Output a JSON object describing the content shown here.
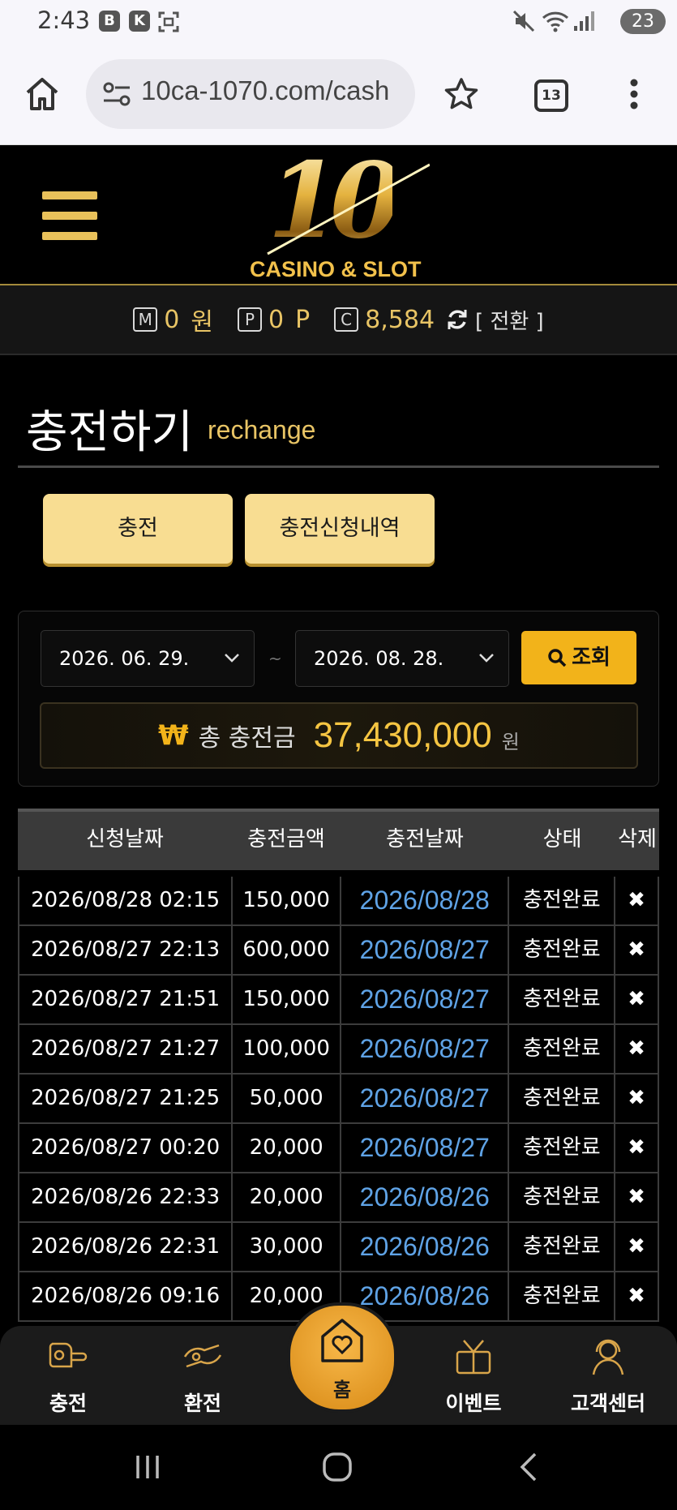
{
  "status_bar": {
    "time": "2:43",
    "apps": [
      "B",
      "K"
    ],
    "battery": "23"
  },
  "browser": {
    "url": "10ca-1070.com/cash",
    "tab_count": "13"
  },
  "site": {
    "logo_number": "10",
    "logo_text": "CASINO & SLOT"
  },
  "balance": {
    "money_icon": "M",
    "money_value": "0",
    "money_unit": "원",
    "point_icon": "P",
    "point_value": "0",
    "point_unit": "P",
    "coin_icon": "C",
    "coin_value": "8,584",
    "convert_label": "[ 전환 ]"
  },
  "page": {
    "title": "충전하기",
    "subtitle": "rechange",
    "tabs": [
      "충전",
      "충전신청내역"
    ]
  },
  "filter": {
    "start_date": "2026. 06. 29.",
    "separator": "~",
    "end_date": "2026. 08. 28.",
    "search_label": "조회",
    "total_sign": "₩",
    "total_label": "총 충전금",
    "total_value": "37,430,000",
    "total_unit": "원"
  },
  "table": {
    "headers": [
      "신청날짜",
      "충전금액",
      "충전날짜",
      "상태",
      "삭제"
    ],
    "rows": [
      [
        "2026/08/28 02:15",
        "150,000",
        "2026/08/28",
        "충전완료",
        "✖"
      ],
      [
        "2026/08/27 22:13",
        "600,000",
        "2026/08/27",
        "충전완료",
        "✖"
      ],
      [
        "2026/08/27 21:51",
        "150,000",
        "2026/08/27",
        "충전완료",
        "✖"
      ],
      [
        "2026/08/27 21:27",
        "100,000",
        "2026/08/27",
        "충전완료",
        "✖"
      ],
      [
        "2026/08/27 21:25",
        "50,000",
        "2026/08/27",
        "충전완료",
        "✖"
      ],
      [
        "2026/08/27 00:20",
        "20,000",
        "2026/08/27",
        "충전완료",
        "✖"
      ],
      [
        "2026/08/26 22:33",
        "20,000",
        "2026/08/26",
        "충전완료",
        "✖"
      ],
      [
        "2026/08/26 22:31",
        "30,000",
        "2026/08/26",
        "충전완료",
        "✖"
      ],
      [
        "2026/08/26 09:16",
        "20,000",
        "2026/08/26",
        "충전완료",
        "✖"
      ]
    ]
  },
  "bottom_nav": {
    "items": [
      "충전",
      "환전",
      "홈",
      "이벤트",
      "고객센터"
    ]
  },
  "colors": {
    "accent_gold": "#f2b31a",
    "link_blue": "#5fa3e6",
    "tab_bg": "#f8dd92"
  }
}
